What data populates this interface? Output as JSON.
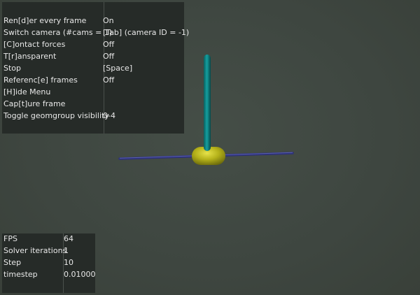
{
  "menu": {
    "items": [
      {
        "label": "Ren[d]er every frame",
        "value": "On"
      },
      {
        "label": "Switch camera (#cams = 1)",
        "value": "[Tab] (camera ID = -1)"
      },
      {
        "label": "[C]ontact forces",
        "value": "Off"
      },
      {
        "label": "T[r]ansparent",
        "value": "Off"
      },
      {
        "label": "Stop",
        "value": "[Space]"
      },
      {
        "label": "Referenc[e] frames",
        "value": "Off"
      },
      {
        "label": "[H]ide Menu",
        "value": ""
      },
      {
        "label": "Cap[t]ure frame",
        "value": ""
      },
      {
        "label": "Toggle geomgroup visibility",
        "value": "0-4"
      }
    ]
  },
  "info": {
    "items": [
      {
        "label": "FPS",
        "value": "64"
      },
      {
        "label": "Solver iterations",
        "value": "1"
      },
      {
        "label": "Step",
        "value": "10"
      },
      {
        "label": "timestep",
        "value": "0.01000"
      }
    ]
  },
  "scene": {
    "colors": {
      "background": "#3f4740",
      "pole": "#0f7f7f",
      "body": "#b5b21a",
      "rail": "#3a3f8c"
    },
    "objects": [
      "rail",
      "cart",
      "pole"
    ]
  }
}
